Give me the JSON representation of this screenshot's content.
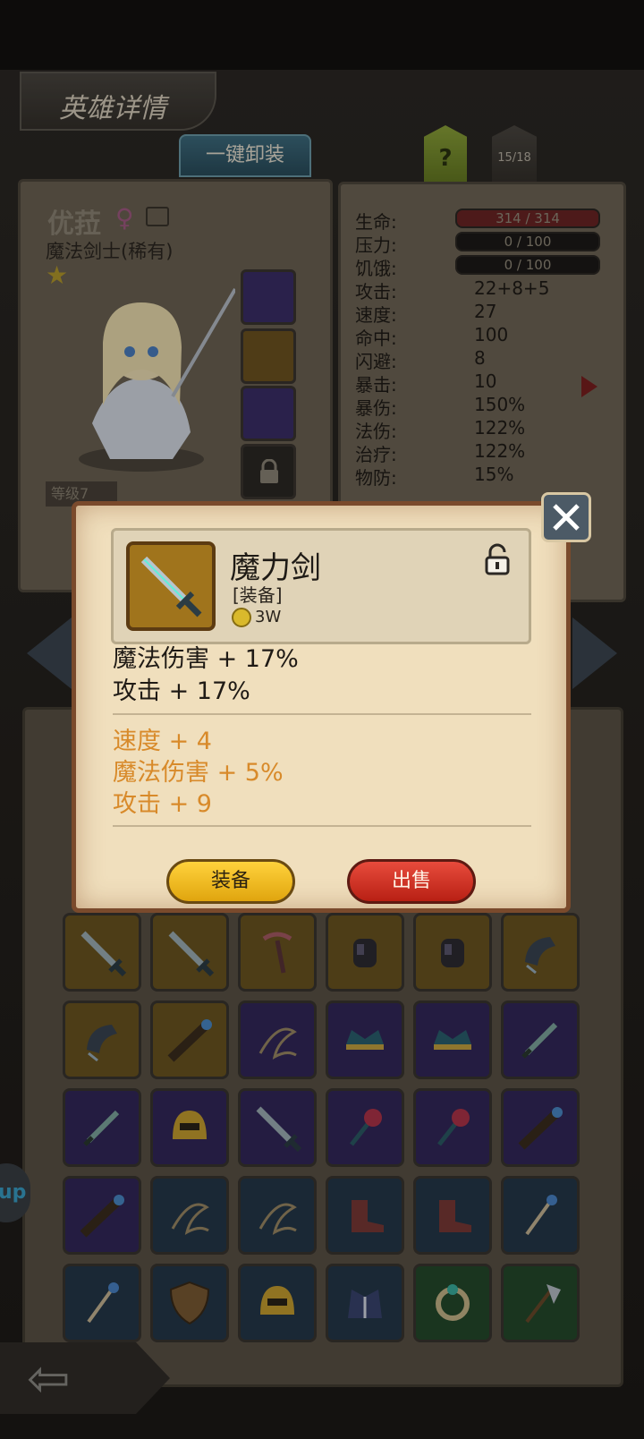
{
  "header": {
    "title": "英雄详情",
    "unequip_all": "一键卸装",
    "help": "?",
    "count": "15/18"
  },
  "hero": {
    "name": "优菈",
    "class": "魔法剑士(稀有)",
    "level_tag": "等级7"
  },
  "stats": [
    {
      "label": "生命:",
      "value": "314 / 314",
      "kind": "bar-hp"
    },
    {
      "label": "压力:",
      "value": "0 / 100",
      "kind": "bar"
    },
    {
      "label": "饥饿:",
      "value": "0 / 100",
      "kind": "bar"
    },
    {
      "label": "攻击:",
      "value": "22+8+5"
    },
    {
      "label": "速度:",
      "value": "27"
    },
    {
      "label": "命中:",
      "value": "100"
    },
    {
      "label": "闪避:",
      "value": "8"
    },
    {
      "label": "暴击:",
      "value": "10"
    },
    {
      "label": "暴伤:",
      "value": "150%"
    },
    {
      "label": "法伤:",
      "value": "122%"
    },
    {
      "label": "治疗:",
      "value": "122%"
    },
    {
      "label": "物防:",
      "value": "15%"
    }
  ],
  "popup": {
    "item_name": "魔力剑",
    "item_type": "[装备]",
    "price": "3W",
    "main_stats": [
      "魔法伤害 + 17%",
      "攻击 + 17%"
    ],
    "extra_stats": [
      "速度 + 4",
      "魔法伤害 + 5%",
      "攻击 + 9"
    ],
    "equip_label": "装备",
    "sell_label": "出售"
  },
  "side_pill": "up",
  "inventory": [
    {
      "name": "sword-icon",
      "quality": "orange"
    },
    {
      "name": "sword-icon",
      "quality": "orange"
    },
    {
      "name": "horn-staff-icon",
      "quality": "orange"
    },
    {
      "name": "gauntlet-icon",
      "quality": "orange"
    },
    {
      "name": "gauntlet-icon",
      "quality": "orange"
    },
    {
      "name": "claw-glove-icon",
      "quality": "orange"
    },
    {
      "name": "claw-glove-icon",
      "quality": "orange"
    },
    {
      "name": "telescope-icon",
      "quality": "orange"
    },
    {
      "name": "whip-icon",
      "quality": "purple"
    },
    {
      "name": "crown-icon",
      "quality": "purple"
    },
    {
      "name": "crown-icon",
      "quality": "purple"
    },
    {
      "name": "dagger-icon",
      "quality": "purple"
    },
    {
      "name": "dagger-icon",
      "quality": "purple"
    },
    {
      "name": "helmet-icon",
      "quality": "purple"
    },
    {
      "name": "sword-icon",
      "quality": "purple"
    },
    {
      "name": "mace-icon",
      "quality": "purple"
    },
    {
      "name": "mace-icon",
      "quality": "purple"
    },
    {
      "name": "telescope-icon",
      "quality": "purple"
    },
    {
      "name": "telescope-icon",
      "quality": "purple"
    },
    {
      "name": "whip-icon",
      "quality": "blue"
    },
    {
      "name": "whip-icon",
      "quality": "blue"
    },
    {
      "name": "boots-icon",
      "quality": "blue"
    },
    {
      "name": "boots-icon",
      "quality": "blue"
    },
    {
      "name": "staff-icon",
      "quality": "blue"
    },
    {
      "name": "staff-icon",
      "quality": "blue"
    },
    {
      "name": "shield-icon",
      "quality": "blue"
    },
    {
      "name": "helmet-icon",
      "quality": "blue"
    },
    {
      "name": "armor-icon",
      "quality": "blue"
    },
    {
      "name": "ring-icon",
      "quality": "green"
    },
    {
      "name": "axe-icon",
      "quality": "green"
    }
  ]
}
